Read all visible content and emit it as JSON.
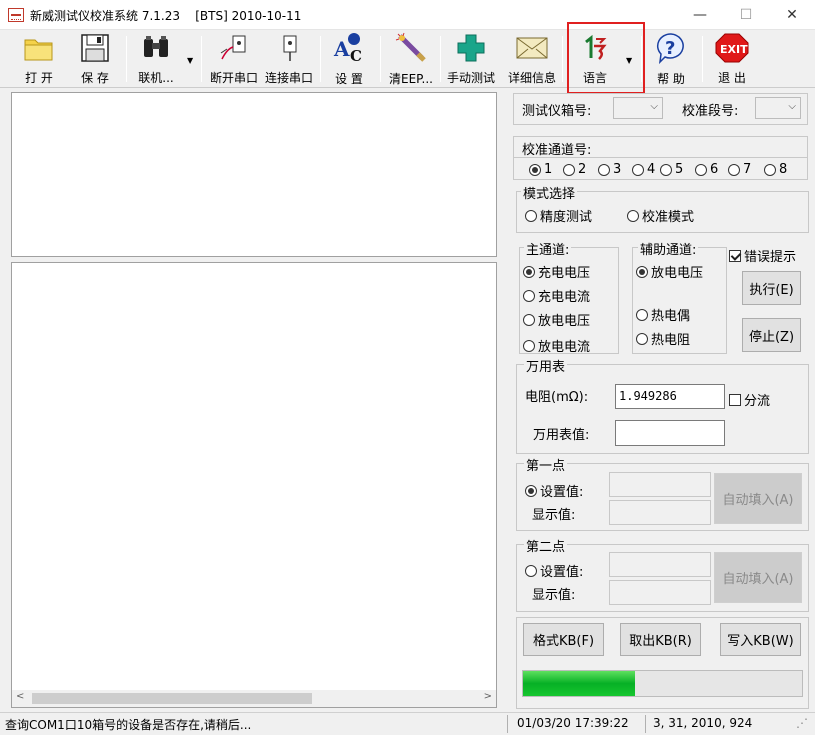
{
  "window": {
    "title": "新威测试仪校准系统 7.1.23    [BTS] 2010-10-11",
    "minimize": "—",
    "maximize": "☐",
    "close": "✕"
  },
  "toolbar": {
    "open": "打 开",
    "save": "保 存",
    "connect": "联机...",
    "disconnect_port": "断开串口",
    "connect_port": "连接串口",
    "settings": "设 置",
    "clear_eep": "清EEP...",
    "manual_test": "手动测试",
    "details": "详细信息",
    "language": "语言",
    "help": "帮 助",
    "exit": "退 出",
    "exit_icon_text": "EXIT",
    "settings_icon_text_a": "A",
    "settings_icon_text_b": "C",
    "help_icon_text": "?"
  },
  "top": {
    "tester_box_label": "测试仪箱号:",
    "tester_box_value": "",
    "calib_segment_label": "校准段号:",
    "calib_segment_value": ""
  },
  "channel": {
    "label": "校准通道号:",
    "options": [
      "1",
      "2",
      "3",
      "4",
      "5",
      "6",
      "7",
      "8"
    ],
    "selected": "1"
  },
  "mode": {
    "label": "模式选择",
    "precision_test": "精度测试",
    "calib_mode": "校准模式"
  },
  "main_channel": {
    "label": "主通道:",
    "options": [
      "充电电压",
      "充电电流",
      "放电电压",
      "放电电流"
    ],
    "selected": "充电电压"
  },
  "aux_channel": {
    "label": "辅助通道:",
    "options": [
      "放电电压",
      "热电偶",
      "热电阻"
    ],
    "selected": "放电电压"
  },
  "error_prompt": {
    "label": "错误提示",
    "checked": true
  },
  "actions": {
    "execute": "执行(E)",
    "stop": "停止(Z)"
  },
  "multimeter": {
    "label": "万用表",
    "resistance_label": "电阻(mΩ):",
    "resistance_value": "1.949286",
    "shunt_label": "分流",
    "shunt_checked": false,
    "value_label": "万用表值:",
    "value": ""
  },
  "point1": {
    "label": "第一点",
    "set_value_label": "设置值:",
    "display_value_label": "显示值:",
    "selected": true,
    "auto_fill": "自动填入(A)"
  },
  "point2": {
    "label": "第二点",
    "set_value_label": "设置值:",
    "display_value_label": "显示值:",
    "selected": false,
    "auto_fill": "自动填入(A)"
  },
  "kb": {
    "format": "格式KB(F)",
    "fetch": "取出KB(R)",
    "write": "写入KB(W)"
  },
  "progress": {
    "fraction": 0.4
  },
  "statusbar": {
    "message": "查询COM1口10箱号的设备是否存在,请稍后...",
    "datetime": "01/03/20 17:39:22",
    "info": "3, 31, 2010, 924"
  },
  "colors": {
    "highlight": "#e02020",
    "progress": "#06b025"
  }
}
